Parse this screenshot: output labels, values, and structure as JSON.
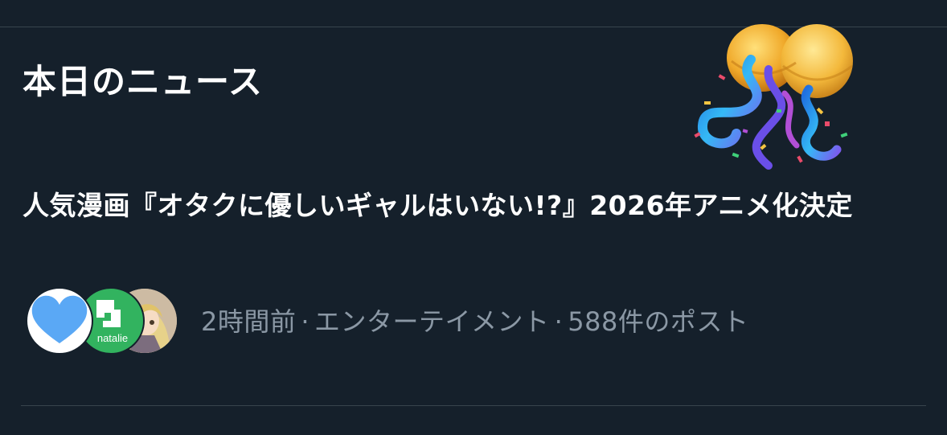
{
  "trend": {
    "section_title": "本日のニュース",
    "headline": "人気漫画『オタクに優しいギャルはいない!?』2026年アニメ化決定",
    "time_ago": "2時間前",
    "separator": "·",
    "category": "エンターテイメント",
    "post_count": "588件のポスト",
    "avatars": [
      {
        "icon": "blue-heart-icon",
        "color": "#5aa8f5"
      },
      {
        "icon": "natalie-logo-icon",
        "label": "natalie",
        "color": "#32b35f"
      },
      {
        "icon": "anime-character-avatar"
      }
    ],
    "decoration_icon": "party-popper-confetti-icon"
  },
  "colors": {
    "background": "#15202b",
    "text_primary": "#ffffff",
    "text_secondary": "#8b98a5",
    "divider": "#38444d"
  }
}
